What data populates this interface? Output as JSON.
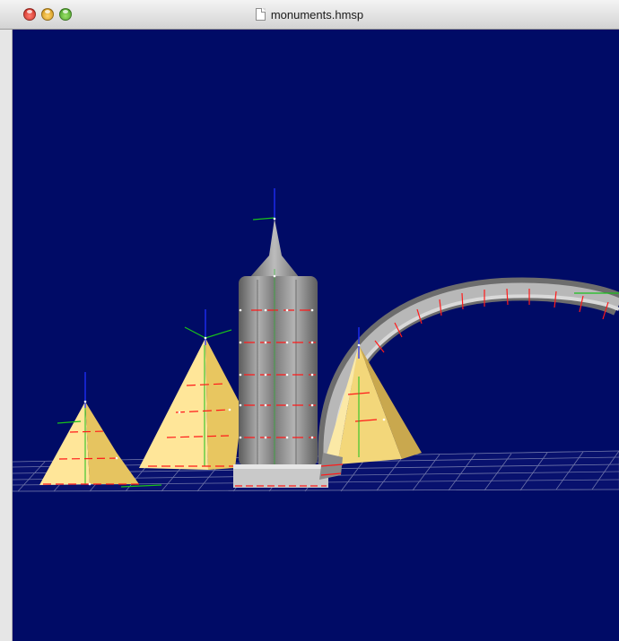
{
  "window": {
    "title": "monuments.hmsp",
    "document_icon": "document-icon",
    "traffic_lights": [
      "close-button",
      "minimize-button",
      "zoom-button"
    ]
  },
  "scene": {
    "background_color": "#000b66",
    "ground_grid_color": "#7a80b0",
    "pyramid_color": "#ffe38a",
    "tower_color": "#8f8f8f",
    "arch_color": "#9c9c9c",
    "axis_colors": {
      "up": "#2030ff",
      "side": "#19c01b",
      "cross": "#ff1a1a"
    },
    "objects": [
      "pyramid-small",
      "pyramid-medium",
      "tower",
      "pyramid-back",
      "arch",
      "ground-grid"
    ]
  }
}
